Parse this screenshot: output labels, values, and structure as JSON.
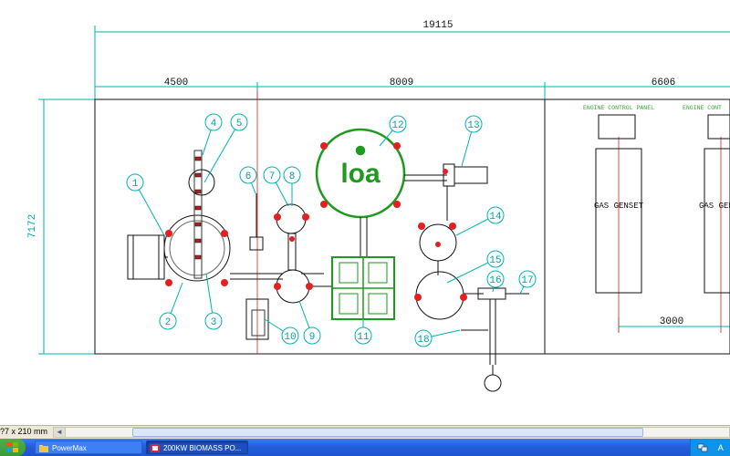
{
  "drawing": {
    "dimensions": {
      "overall": "19115",
      "left": "4500",
      "middle": "8009",
      "right": "6606",
      "height": "7172",
      "genset_spacing": "3000"
    },
    "labels": {
      "engine_panel_1": "ENGINE CONTROL PANEL",
      "engine_panel_2": "ENGINE CONT",
      "genset_1": "GAS GENSET",
      "genset_2": "GAS GENSE"
    },
    "balloons": [
      "1",
      "2",
      "3",
      "4",
      "5",
      "6",
      "7",
      "8",
      "9",
      "10",
      "11",
      "12",
      "13",
      "14",
      "15",
      "16",
      "17",
      "18"
    ],
    "logo": "loa"
  },
  "colors": {
    "dimension": "#00b3b3",
    "balloon": "#00b3b3",
    "green": "#1e9a1e",
    "red": "#e32020",
    "outline": "#111111",
    "panel_text": "#33aa33"
  },
  "statusbar": {
    "paper_size": "?7 x 210 mm"
  },
  "taskbar": {
    "items": [
      {
        "label": "PowerMax",
        "icon": "folder-icon"
      },
      {
        "label": "200KW BIOMASS PO...",
        "icon": "pdf-icon"
      }
    ],
    "tray_lang": "A"
  }
}
